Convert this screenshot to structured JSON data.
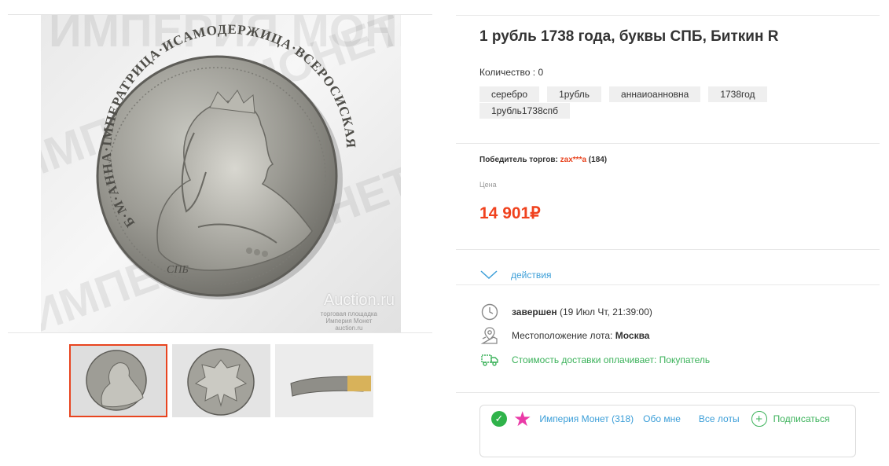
{
  "lot": {
    "title": "1 рубль 1738 года, буквы СПБ, Биткин R",
    "quantity_label": "Количество",
    "quantity_value": "0",
    "tags": [
      "серебро",
      "1рубль",
      "аннаиоанновна",
      "1738год",
      "1рубль1738спб"
    ]
  },
  "auction": {
    "winner_label": "Победитель торгов:",
    "winner_nick": "zax***a",
    "winner_rating": "(184)",
    "price_label": "Цена",
    "price": "14 901₽",
    "actions_label": "действия"
  },
  "info": {
    "status": "завершен",
    "status_time": "(19 Июл Чт, 21:39:00)",
    "location_label": "Местоположение лота:",
    "location_value": "Москва",
    "delivery": "Стоимость доставки оплачивает: Покупатель"
  },
  "seller": {
    "name": "Империя Монет (318)",
    "about": "Обо мне",
    "all_lots": "Все лоты",
    "subscribe": "Подписаться"
  },
  "photo": {
    "watermark": "Auction.ru",
    "watermark_sub": [
      "торговая площадка",
      "Империя Монет",
      "auction.ru"
    ],
    "coin_legend": "Б·М·АННА·IМПЕРАТРИЦА·ИСАМОДЕРЖИЦА·ВСЕРОСИСКАЯ",
    "mint_mark": "СПБ",
    "background_text": "ИМПЕРИЯ МОНЕТ"
  },
  "colors": {
    "accent_red": "#f0421e",
    "link_blue": "#3b9ed8",
    "green": "#3bb25a",
    "star_pink": "#ea3aa7"
  }
}
